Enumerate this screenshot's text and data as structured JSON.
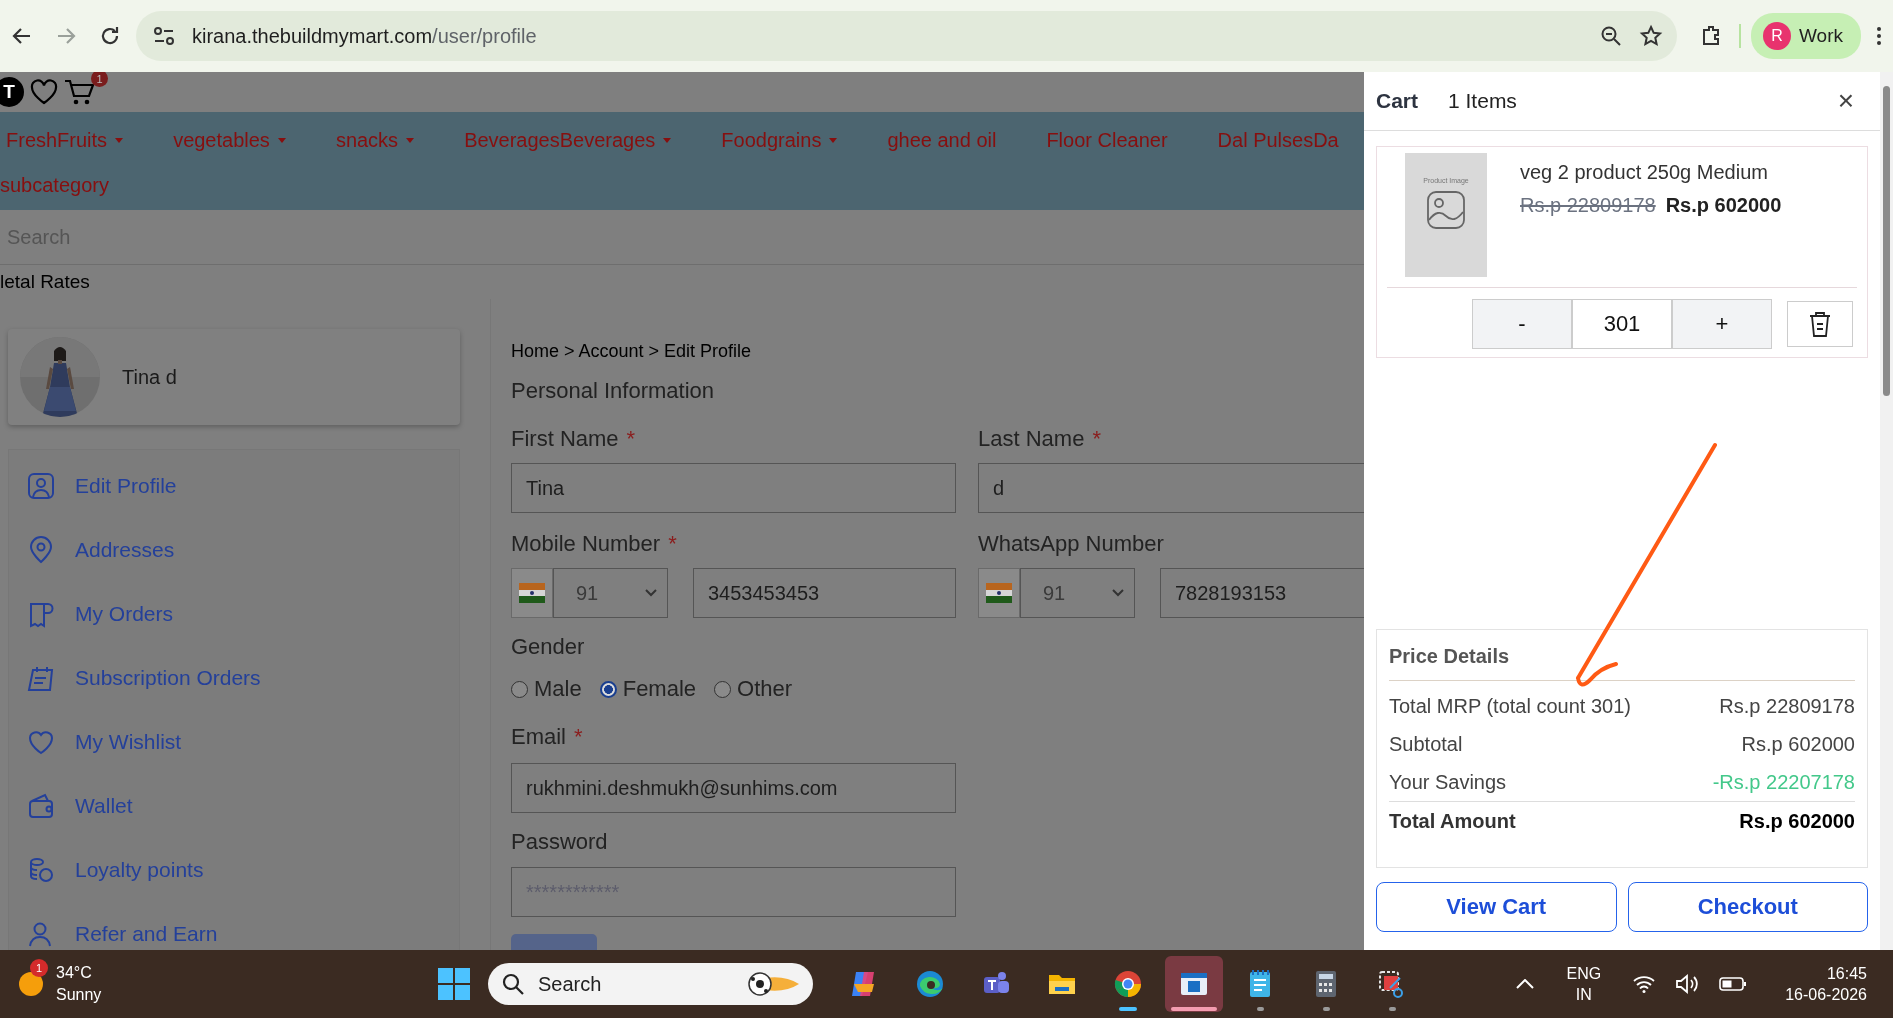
{
  "browser": {
    "url_host": "kirana.thebuildmymart.com",
    "url_path": "/user/profile",
    "profile": {
      "initial": "R",
      "label": "Work"
    }
  },
  "header": {
    "avatar": "T",
    "cart_badge": "1"
  },
  "categories": [
    {
      "label": "FreshFruits",
      "dropdown": true
    },
    {
      "label": "vegetables",
      "dropdown": true
    },
    {
      "label": "snacks",
      "dropdown": true
    },
    {
      "label": "BeveragesBeverages",
      "dropdown": true
    },
    {
      "label": "Foodgrains",
      "dropdown": true
    },
    {
      "label": "ghee and oil",
      "dropdown": false
    },
    {
      "label": "Floor Cleaner",
      "dropdown": false
    },
    {
      "label": "Dal PulsesDa",
      "dropdown": false
    }
  ],
  "subcategory": "subcategory",
  "search": {
    "placeholder": "Search"
  },
  "metal_rates": "letal Rates",
  "profile": {
    "name": "Tina d"
  },
  "sidebar": {
    "items": [
      {
        "label": "Edit Profile"
      },
      {
        "label": "Addresses"
      },
      {
        "label": "My Orders"
      },
      {
        "label": "Subscription Orders"
      },
      {
        "label": "My Wishlist"
      },
      {
        "label": "Wallet"
      },
      {
        "label": "Loyalty points"
      },
      {
        "label": "Refer and Earn"
      }
    ]
  },
  "form": {
    "breadcrumb": "Home > Account > Edit Profile",
    "section_title": "Personal Information",
    "first_name": {
      "label": "First Name",
      "marker": "*",
      "value": "Tina"
    },
    "last_name": {
      "label": "Last Name",
      "marker": "*",
      "value": "d"
    },
    "mobile": {
      "label": "Mobile Number",
      "marker": "*",
      "code": "91",
      "value": "3453453453"
    },
    "whatsapp": {
      "label": "WhatsApp Number",
      "code": "91",
      "value": "7828193153"
    },
    "gender": {
      "label": "Gender",
      "options": [
        {
          "label": "Male",
          "selected": false
        },
        {
          "label": "Female",
          "selected": true
        },
        {
          "label": "Other",
          "selected": false
        }
      ]
    },
    "email": {
      "label": "Email",
      "marker": "*",
      "value": "rukhmini.deshmukh@sunhims.com"
    },
    "password": {
      "label": "Password",
      "placeholder": "************"
    }
  },
  "cart": {
    "title": "Cart",
    "count": "1 Items",
    "close": "×",
    "item": {
      "image_label": "Product Image",
      "name": "veg 2 product 250g Medium",
      "mrp": "Rs.p 22809178",
      "price": "Rs.p 602000",
      "minus": "-",
      "quantity": "301",
      "plus": "+"
    },
    "price_details": {
      "title": "Price Details",
      "rows": [
        {
          "label": "Total MRP (total count 301)",
          "value": "Rs.p 22809178",
          "kind": "normal"
        },
        {
          "label": "Subtotal",
          "value": "Rs.p 602000",
          "kind": "normal"
        },
        {
          "label": "Your Savings",
          "value": "-Rs.p 22207178",
          "kind": "savings"
        },
        {
          "label": "Total Amount",
          "value": "Rs.p 602000",
          "kind": "total"
        }
      ]
    },
    "buttons": [
      "View Cart",
      "Checkout"
    ]
  },
  "taskbar": {
    "weather": {
      "badge": "1",
      "temperature": "34°C",
      "condition": "Sunny"
    },
    "search": "Search",
    "apps": [
      {
        "running": false,
        "active": false
      },
      {
        "running": false,
        "active": false
      },
      {
        "running": false,
        "active": false
      },
      {
        "running": false,
        "active": false
      },
      {
        "running": true,
        "active": false
      },
      {
        "running": true,
        "active": true
      },
      {
        "running": true,
        "active": false
      },
      {
        "running": true,
        "active": false
      },
      {
        "running": true,
        "active": false
      }
    ],
    "language": "ENG",
    "region": "IN",
    "time": "16:45",
    "date": "16-06-2026"
  }
}
